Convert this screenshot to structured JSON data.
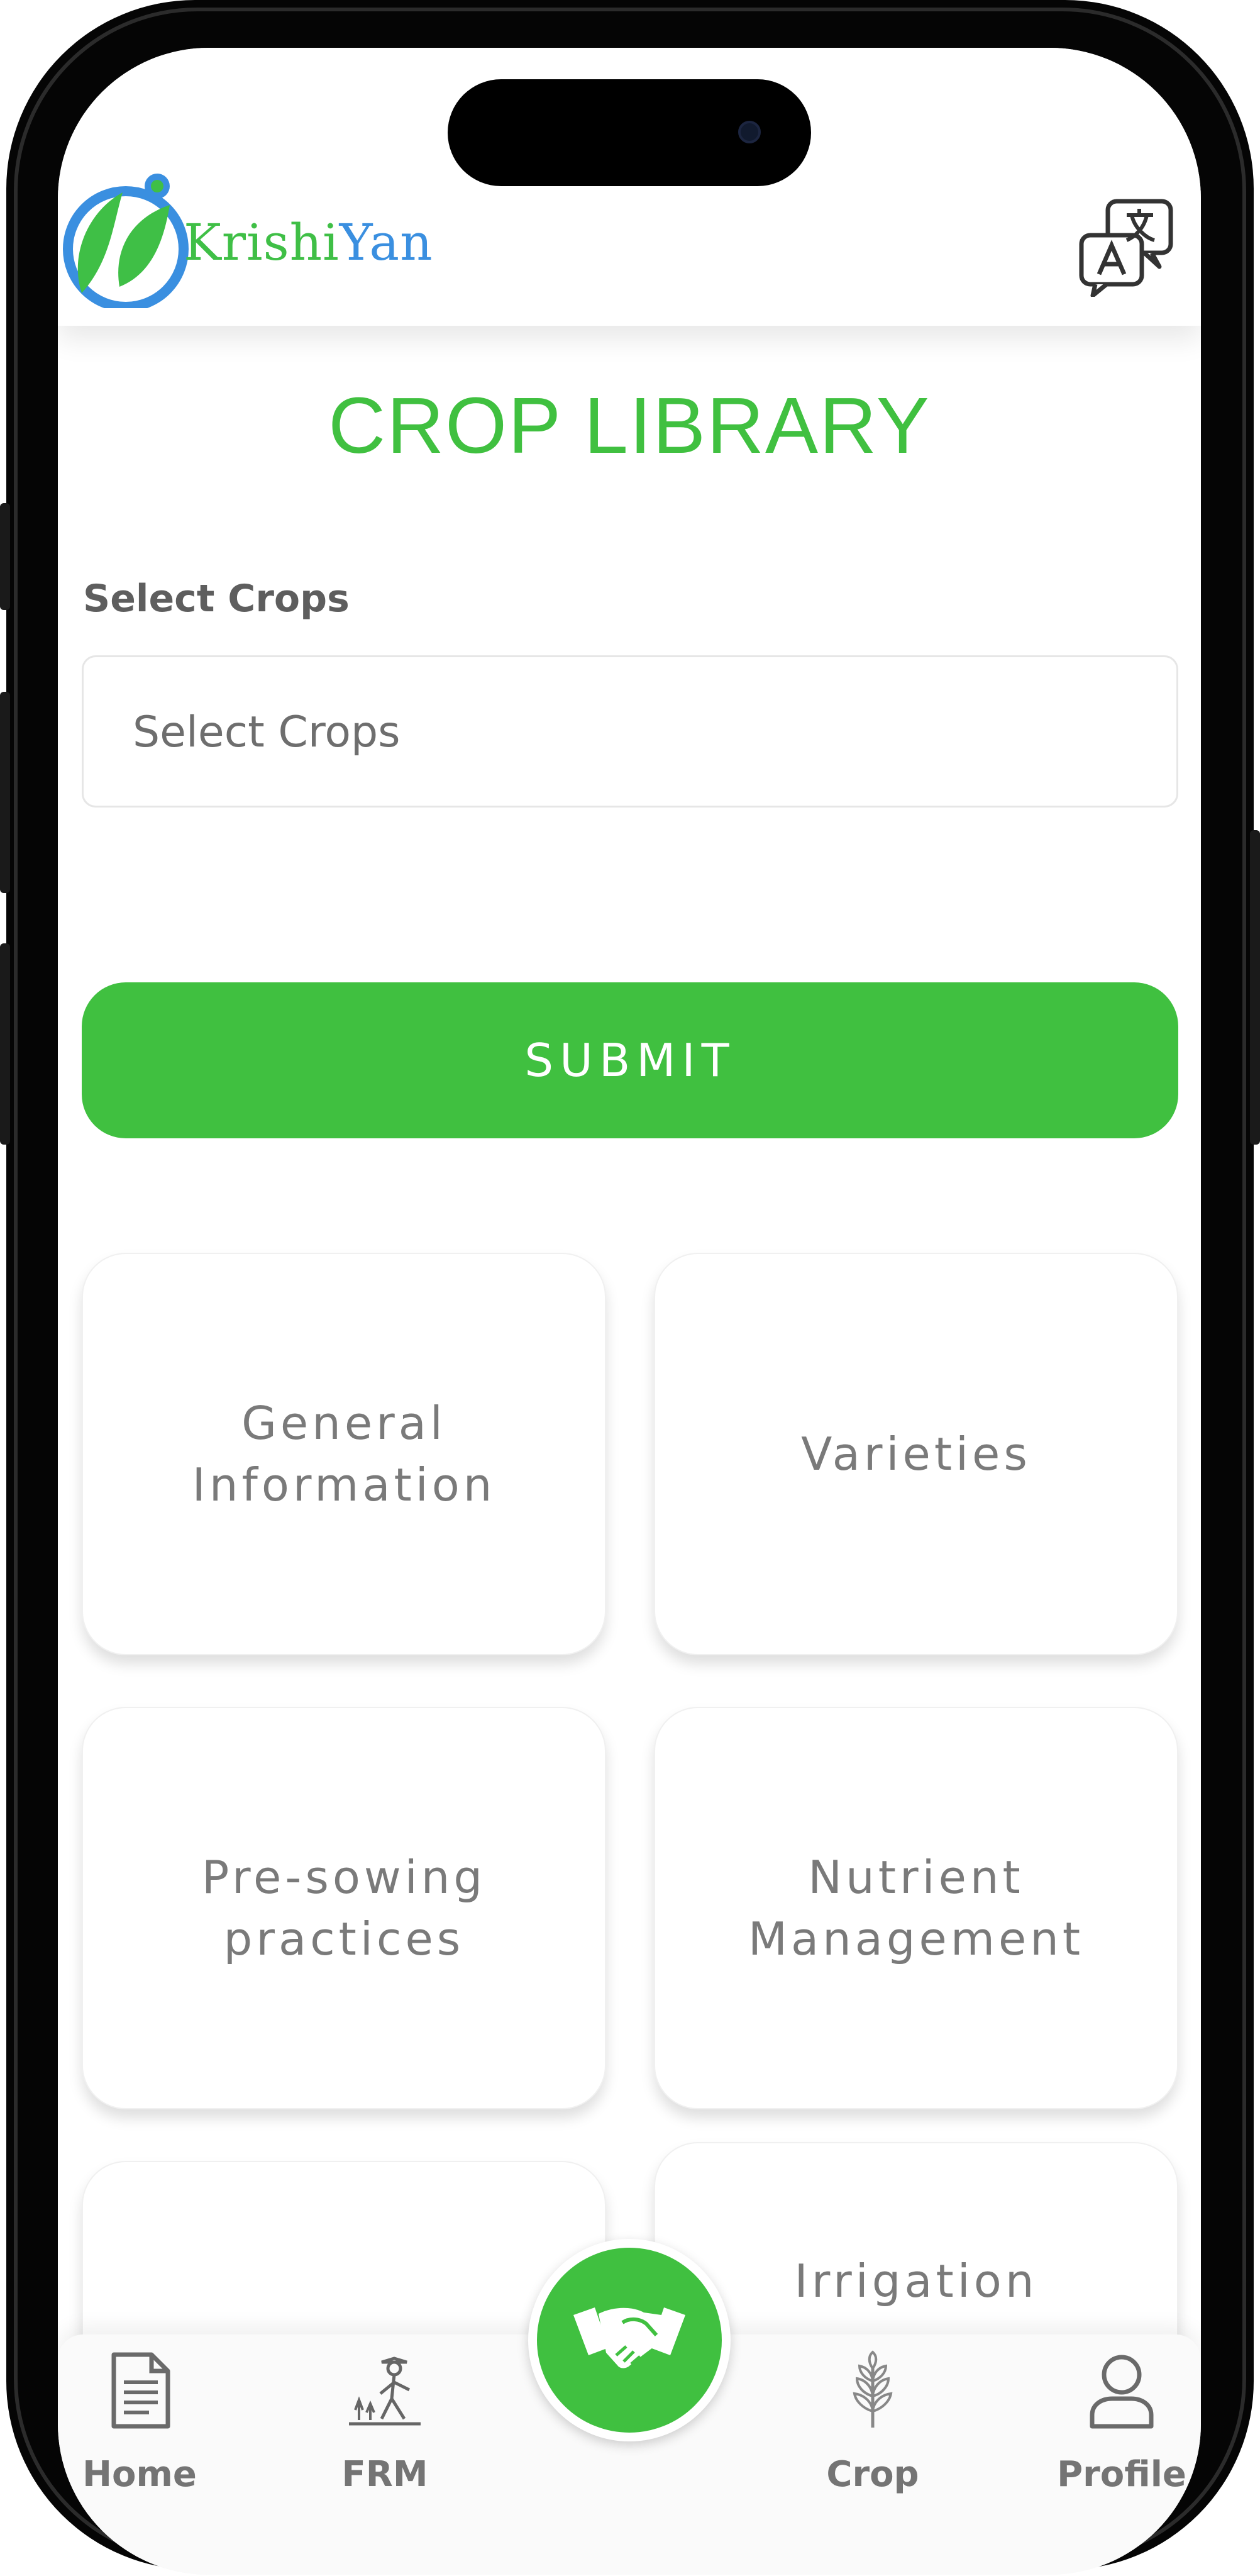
{
  "header": {
    "brand_part1": "Krishi",
    "brand_part2": "Yan"
  },
  "page": {
    "title": "CROP LIBRARY"
  },
  "form": {
    "label": "Select Crops",
    "select_placeholder": "Select Crops",
    "submit_label": "SUBMIT"
  },
  "cards": [
    {
      "label": "General\nInformation"
    },
    {
      "label": "Varieties"
    },
    {
      "label": "Pre-sowing\npractices"
    },
    {
      "label": "Nutrient\nManagement"
    },
    {
      "label": ""
    },
    {
      "label": "Irrigation"
    }
  ],
  "bottom_nav": [
    {
      "label": "Home",
      "icon": "document-icon"
    },
    {
      "label": "FRM",
      "icon": "farmer-icon"
    },
    {
      "label": "Crop",
      "icon": "wheat-icon"
    },
    {
      "label": "Profile",
      "icon": "user-icon"
    }
  ],
  "fab": {
    "icon": "handshake-icon"
  },
  "colors": {
    "accent_green": "#40c040",
    "brand_blue": "#3a8fe0",
    "text_gray": "#7a7a7a"
  }
}
